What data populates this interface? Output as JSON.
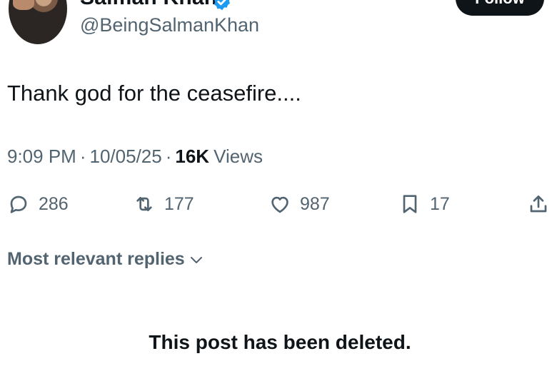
{
  "author": {
    "display_name": "Salman Khan",
    "handle": "@BeingSalmanKhan",
    "verified_icon": "verified-badge-icon",
    "follow_label": "Follow"
  },
  "post": {
    "text": "Thank god for the ceasefire....",
    "time": "9:09 PM",
    "date": "10/05/25",
    "separator": "·",
    "views_count": "16K",
    "views_label": "Views"
  },
  "actions": {
    "replies": "286",
    "reposts": "177",
    "likes": "987",
    "bookmarks": "17"
  },
  "replies_section": {
    "sort_label": "Most relevant replies",
    "deleted_notice": "This post has been deleted."
  },
  "colors": {
    "text": "#0f1419",
    "secondary": "#536471",
    "verified_blue": "#1d9bf0"
  }
}
